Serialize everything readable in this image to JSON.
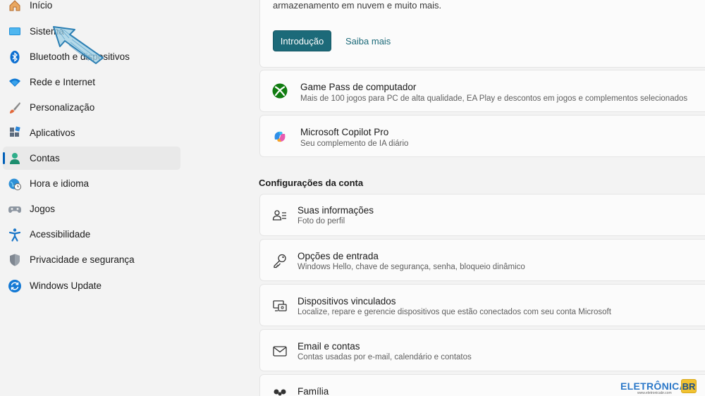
{
  "sidebar": {
    "items": [
      {
        "label": "Início",
        "icon": "home-icon"
      },
      {
        "label": "Sistema",
        "icon": "system-icon"
      },
      {
        "label": "Bluetooth e dispositivos",
        "icon": "bluetooth-icon"
      },
      {
        "label": "Rede e Internet",
        "icon": "wifi-icon"
      },
      {
        "label": "Personalização",
        "icon": "brush-icon"
      },
      {
        "label": "Aplicativos",
        "icon": "apps-icon"
      },
      {
        "label": "Contas",
        "icon": "account-icon",
        "active": true
      },
      {
        "label": "Hora e idioma",
        "icon": "clock-globe-icon"
      },
      {
        "label": "Jogos",
        "icon": "gamepad-icon"
      },
      {
        "label": "Acessibilidade",
        "icon": "accessibility-icon"
      },
      {
        "label": "Privacidade e segurança",
        "icon": "shield-icon"
      },
      {
        "label": "Windows Update",
        "icon": "update-icon"
      }
    ]
  },
  "top_card": {
    "text": "armazenamento em nuvem e muito mais.",
    "primary_button": "Introdução",
    "link_button": "Saiba mais"
  },
  "promos": [
    {
      "title": "Game Pass de computador",
      "subtitle": "Mais de 100 jogos para PC de alta qualidade, EA Play e descontos em jogos e complementos selecionados",
      "icon": "xbox-icon"
    },
    {
      "title": "Microsoft Copilot Pro",
      "subtitle": "Seu complemento de IA diário",
      "icon": "copilot-icon"
    }
  ],
  "account_settings": {
    "heading": "Configurações da conta",
    "items": [
      {
        "title": "Suas informações",
        "subtitle": "Foto do perfil",
        "icon": "person-info-icon"
      },
      {
        "title": "Opções de entrada",
        "subtitle": "Windows Hello, chave de segurança, senha, bloqueio dinâmico",
        "icon": "key-icon"
      },
      {
        "title": "Dispositivos vinculados",
        "subtitle": "Localize, repare e gerencie dispositivos que estão conectados com seu conta Microsoft",
        "icon": "linked-devices-icon"
      },
      {
        "title": "Email e contas",
        "subtitle": "Contas usadas por e-mail, calendário e contatos",
        "icon": "mail-icon"
      },
      {
        "title": "Família",
        "subtitle": "",
        "icon": "family-icon"
      }
    ]
  },
  "watermark": {
    "text": "ELETRÔNICA",
    "badge": "BR",
    "sub": "www.eletronicabr.com"
  },
  "colors": {
    "accent": "#1c6a79",
    "active_indicator": "#005fb8"
  }
}
